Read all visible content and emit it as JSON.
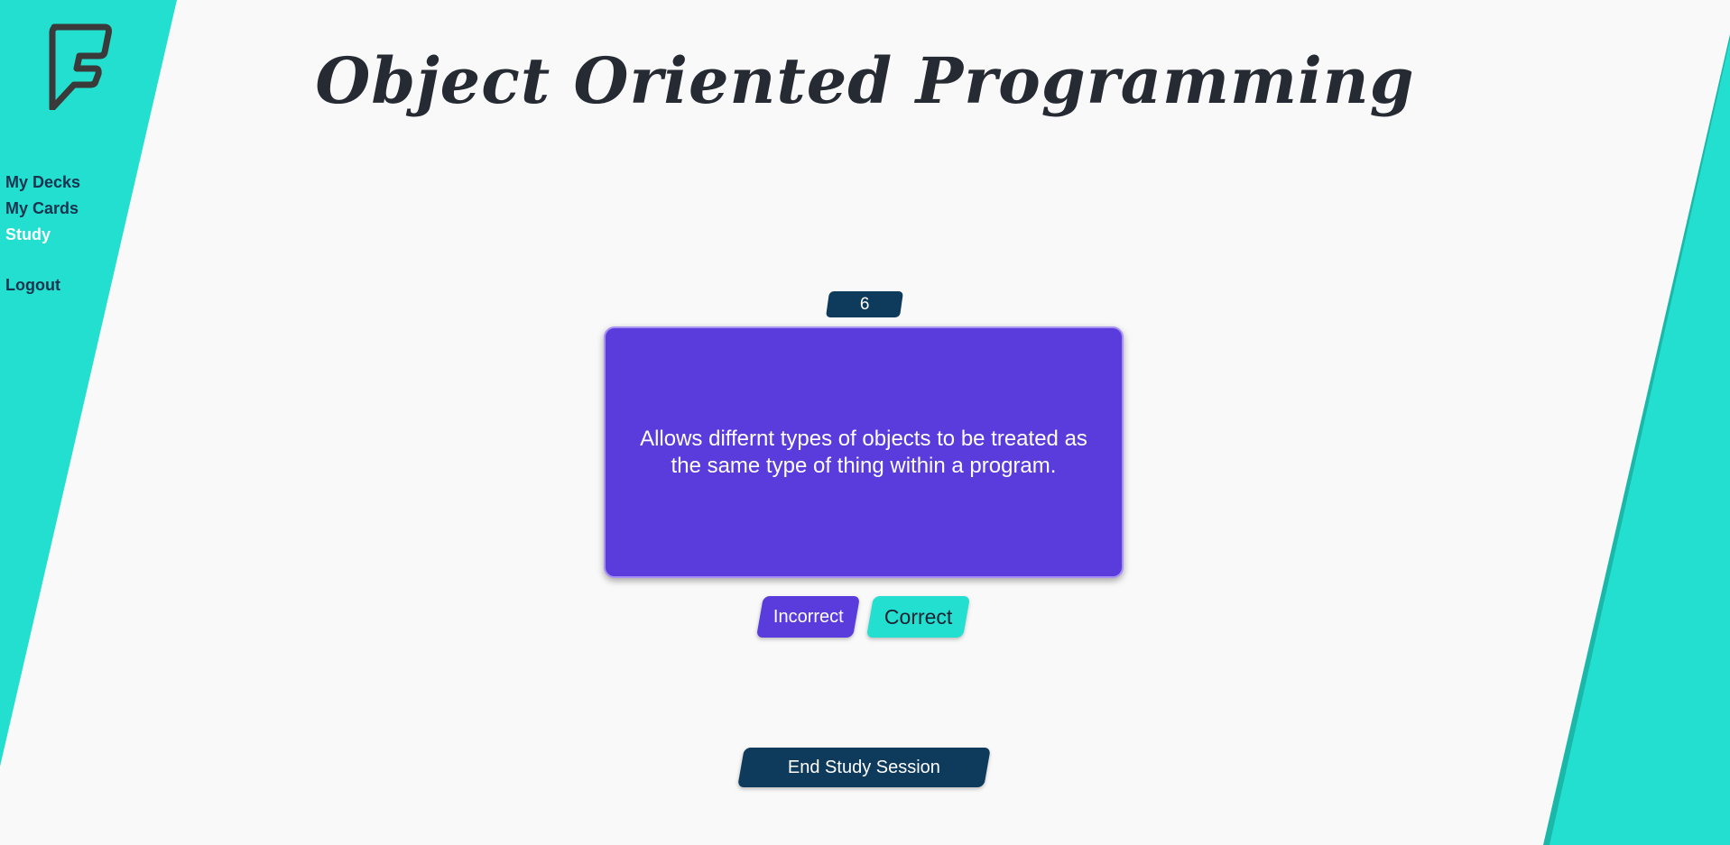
{
  "colors": {
    "accent_teal": "#22dfcf",
    "card_purple": "#5a3bdb",
    "navy": "#0e3a5c",
    "background": "#f9f9f9"
  },
  "logo": {
    "icon": "foursquare-f-logo"
  },
  "nav": {
    "my_decks": "My Decks",
    "my_cards": "My Cards",
    "study": "Study",
    "logout": "Logout"
  },
  "page": {
    "title": "Object Oriented Programming"
  },
  "study": {
    "card_number": "6",
    "card_text": "Allows differnt types of objects to be treated as the same type of thing within a program.",
    "incorrect_label": "Incorrect",
    "correct_label": "Correct",
    "end_session_label": "End Study Session"
  }
}
